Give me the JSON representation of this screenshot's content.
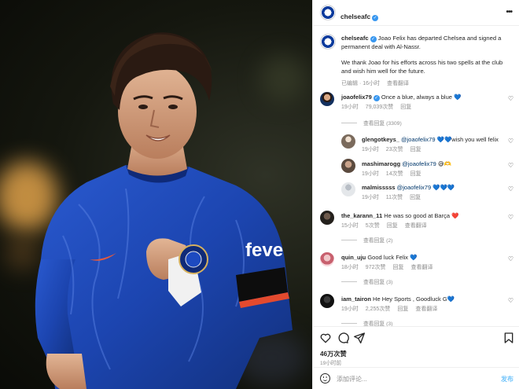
{
  "header": {
    "username": "chelseafc",
    "more_icon": "ellipsis-icon"
  },
  "photo": {
    "alt": "",
    "colors": {
      "kit": "#1f49b8",
      "background": "#14160f",
      "light": "#e0a24a"
    },
    "chest_text": "feve"
  },
  "caption": {
    "username": "chelseafc",
    "line1": "Joao Felix has departed Chelsea and signed a permanent deal with Al-Nassr.",
    "line2": "We thank Joao for his efforts across his two spells at the club and wish him well for the future.",
    "edited": "已编辑 · 16小时",
    "translate": "查看翻译"
  },
  "comments": [
    {
      "username": "joaofelix79",
      "verified": true,
      "text": "Once a blue, always a blue 💙",
      "time": "19小时",
      "likes": "79,039次赞",
      "reply": "回复",
      "view_replies": "查看回复 (3309)"
    },
    {
      "username": "glengotkeys_",
      "mention": "@joaofelix79",
      "text": "💙💙wish you well felix",
      "time": "19小时",
      "likes": "23次赞",
      "reply": "回复"
    },
    {
      "username": "mashimarogg",
      "mention": "@joaofelix79",
      "text": "😅🫶",
      "time": "19小时",
      "likes": "14次赞",
      "reply": "回复"
    },
    {
      "username": "malmisssss",
      "mention": "@joaofelix79",
      "text": "💙💙💙",
      "time": "19小时",
      "likes": "11次赞",
      "reply": "回复"
    },
    {
      "username": "the_karann_11",
      "text": "He was so good at Barça ❤️",
      "time": "15小时",
      "likes": "5次赞",
      "reply": "回复",
      "translate": "查看翻译",
      "view_replies": "查看回复 (2)"
    },
    {
      "username": "quin_uju",
      "text": "Good luck Felix 💙",
      "time": "18小时",
      "likes": "972次赞",
      "reply": "回复",
      "translate": "查看翻译",
      "view_replies": "查看回复 (3)"
    },
    {
      "username": "iam_tairon",
      "text": "He Hey Sports , Goodluck G💙",
      "time": "19小时",
      "likes": "2,255次赞",
      "reply": "回复",
      "translate": "查看翻译",
      "view_replies": "查看回复 (3)"
    }
  ],
  "actions": {
    "likes": "46万次赞",
    "time": "19小时前"
  },
  "composer": {
    "placeholder": "添加评论...",
    "post": "发布"
  }
}
